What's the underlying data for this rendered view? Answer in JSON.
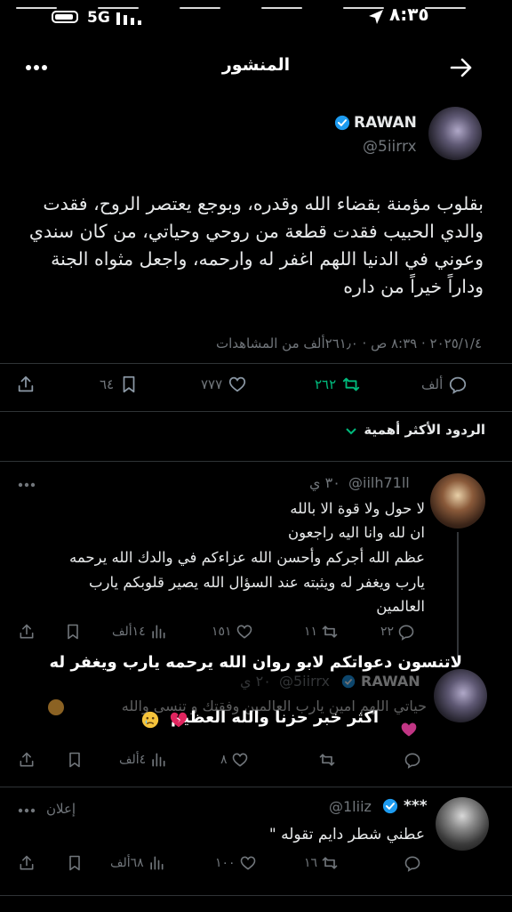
{
  "status_bar": {
    "time": "٨:٣٥",
    "network": "5G"
  },
  "header": {
    "title": "المنشور",
    "back_icon": "arrow-icon",
    "more_icon": "more-dots-icon"
  },
  "post": {
    "display_name": "RAWAN",
    "handle": "@5iirrx",
    "text": "بقلوب مؤمنة بقضاء الله وقدره، وبوجع يعتصر الروح، فقدت والدي الحبيب فقدت قطعة من روحي وحياتي، من كان سندي وعوني في الدنيا اللهم اغفر له وارحمه، واجعل مثواه الجنة وداراً خيراً من داره",
    "meta": "٢٠٢٥/١/٤ · ٨:٣٩ ص · ٢٦١٫٠ألف من المشاهدات",
    "stats": {
      "replies": "ألف",
      "reposts": "٢٦٢",
      "likes": "٧٧٧",
      "bookmarks": "٦٤"
    }
  },
  "replies_sort": {
    "label": "الردود الأكثر أهمية"
  },
  "replies": [
    {
      "handle": "@iilh71ll",
      "time": "٣٠ ي",
      "lines": [
        "لا حول ولا قوة الا بالله",
        "ان لله وانا اليه راجعون",
        "عظم الله أجركم وأحسن الله عزاءكم في والدك الله يرحمه",
        "يارب ويغفر له ويثبته عند السؤال الله يصير قلوبكم يارب",
        "العالمين"
      ],
      "stats": {
        "replies": "٢٢",
        "reposts": "١١",
        "likes": "١٥١",
        "views": "١٤ألف"
      }
    },
    {
      "display_name": "RAWAN",
      "handle": "@5iirrx",
      "time": "٢٠ ي",
      "faded_text_1": "حياتي اللهم امين يارب العالمين وفقتك و تنسى والله",
      "overlay_line_1": "لاتنسون دعواتكم لابو روان الله يرحمه يارب ويغفر له",
      "overlay_line_2": "اكثر خبر حزنا والله العظيم",
      "stats": {
        "replies": "",
        "reposts": "",
        "likes": "٨",
        "views": "٤ألف"
      }
    },
    {
      "display_name": "***",
      "handle": "@1liiz",
      "ad_label": "إعلان",
      "text": "عطني شطر دايم تقوله \"",
      "stats": {
        "replies": "",
        "reposts": "١٦",
        "likes": "١٠٠",
        "views": "٦٨ألف"
      }
    }
  ],
  "colors": {
    "background": "#000000",
    "text": "#e7e9ea",
    "muted": "#71767b",
    "verified": "#1d9bf0",
    "repost_active": "#00ba7c"
  }
}
